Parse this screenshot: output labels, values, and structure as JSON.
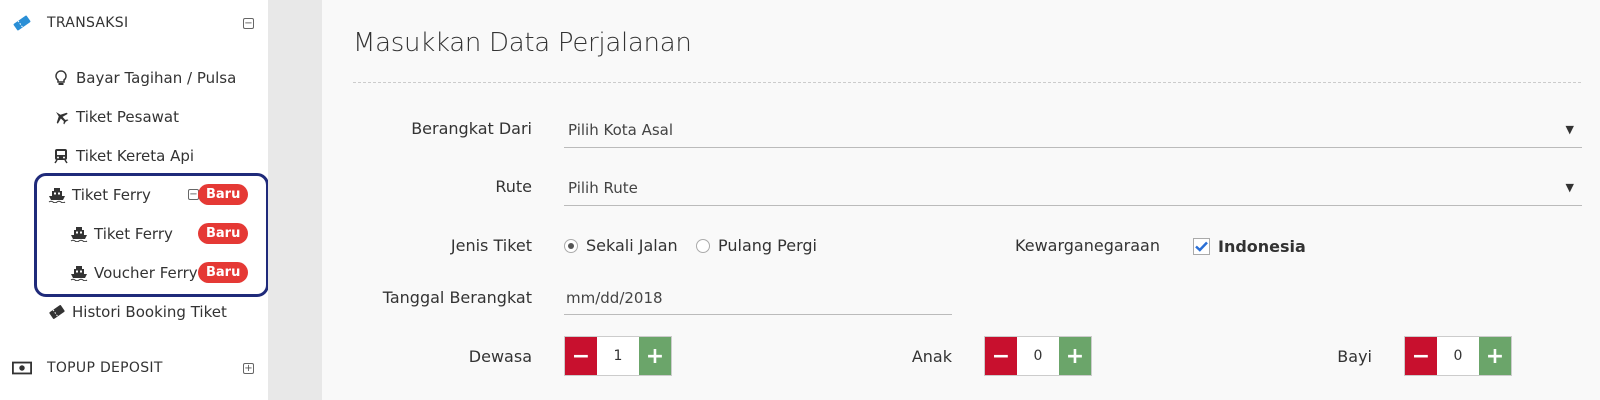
{
  "sidebar": {
    "transaksi": {
      "label": "TRANSAKSI",
      "toggle": "−"
    },
    "items": [
      {
        "label": "Bayar Tagihan / Pulsa"
      },
      {
        "label": "Tiket Pesawat"
      },
      {
        "label": "Tiket Kereta Api"
      },
      {
        "label": "Tiket Ferry",
        "toggle": "−",
        "badge": "Baru"
      },
      {
        "label": "Tiket Ferry",
        "badge": "Baru"
      },
      {
        "label": "Voucher Ferry",
        "badge": "Baru"
      },
      {
        "label": "Histori Booking Tiket"
      }
    ],
    "topup": {
      "label": "TOPUP DEPOSIT",
      "toggle": "+"
    }
  },
  "main": {
    "title": "Masukkan Data Perjalanan",
    "berangkat_dari": {
      "label": "Berangkat Dari",
      "value": "Pilih Kota Asal"
    },
    "rute": {
      "label": "Rute",
      "value": "Pilih Rute"
    },
    "jenis_tiket": {
      "label": "Jenis Tiket",
      "options": [
        "Sekali Jalan",
        "Pulang Pergi"
      ],
      "selected": "Sekali Jalan"
    },
    "kewarganegaraan": {
      "label": "Kewarganegaraan",
      "value": "Indonesia",
      "checked": true
    },
    "tanggal": {
      "label": "Tanggal Berangkat",
      "value": "mm/dd/2018"
    },
    "dewasa": {
      "label": "Dewasa",
      "value": "1"
    },
    "anak": {
      "label": "Anak",
      "value": "0"
    },
    "bayi": {
      "label": "Bayi",
      "value": "0"
    },
    "stepper_minus": "−",
    "stepper_plus": "+"
  },
  "colors": {
    "badge": "#e53935",
    "minus": "#c8102e",
    "plus": "#6ba56a",
    "highlight": "#1f2a7a",
    "check": "#2a6fd6"
  }
}
